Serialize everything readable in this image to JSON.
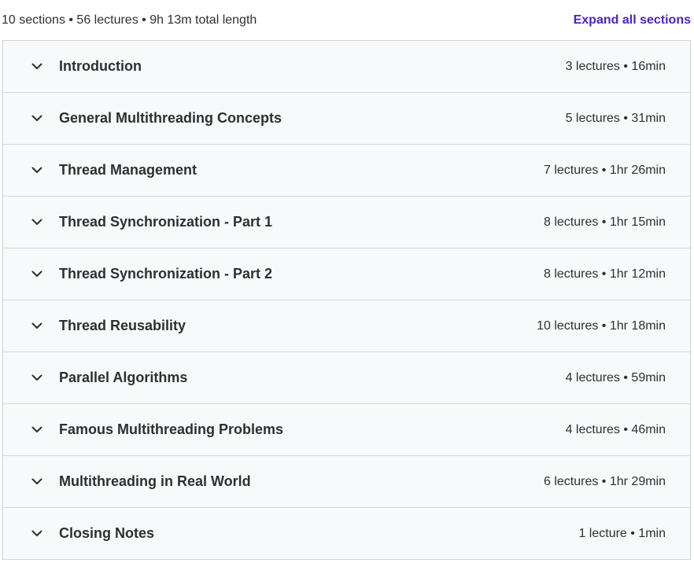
{
  "summary": {
    "text": "10 sections • 56 lectures • 9h 13m total length",
    "expand_label": "Expand all sections"
  },
  "icons": {
    "chevron": "chevron-down-icon"
  },
  "colors": {
    "link": "#5022c3",
    "row_background": "#f7f9fa",
    "border": "#d1d7dc",
    "text": "#2d2f31"
  },
  "sections": [
    {
      "title": "Introduction",
      "meta": "3 lectures • 16min"
    },
    {
      "title": "General Multithreading Concepts",
      "meta": "5 lectures • 31min"
    },
    {
      "title": "Thread Management",
      "meta": "7 lectures • 1hr 26min"
    },
    {
      "title": "Thread Synchronization - Part 1",
      "meta": "8 lectures • 1hr 15min"
    },
    {
      "title": "Thread Synchronization - Part 2",
      "meta": "8 lectures • 1hr 12min"
    },
    {
      "title": "Thread Reusability",
      "meta": "10 lectures • 1hr 18min"
    },
    {
      "title": "Parallel Algorithms",
      "meta": "4 lectures • 59min"
    },
    {
      "title": "Famous Multithreading Problems",
      "meta": "4 lectures • 46min"
    },
    {
      "title": "Multithreading in Real World",
      "meta": "6 lectures • 1hr 29min"
    },
    {
      "title": "Closing Notes",
      "meta": "1 lecture • 1min"
    }
  ]
}
